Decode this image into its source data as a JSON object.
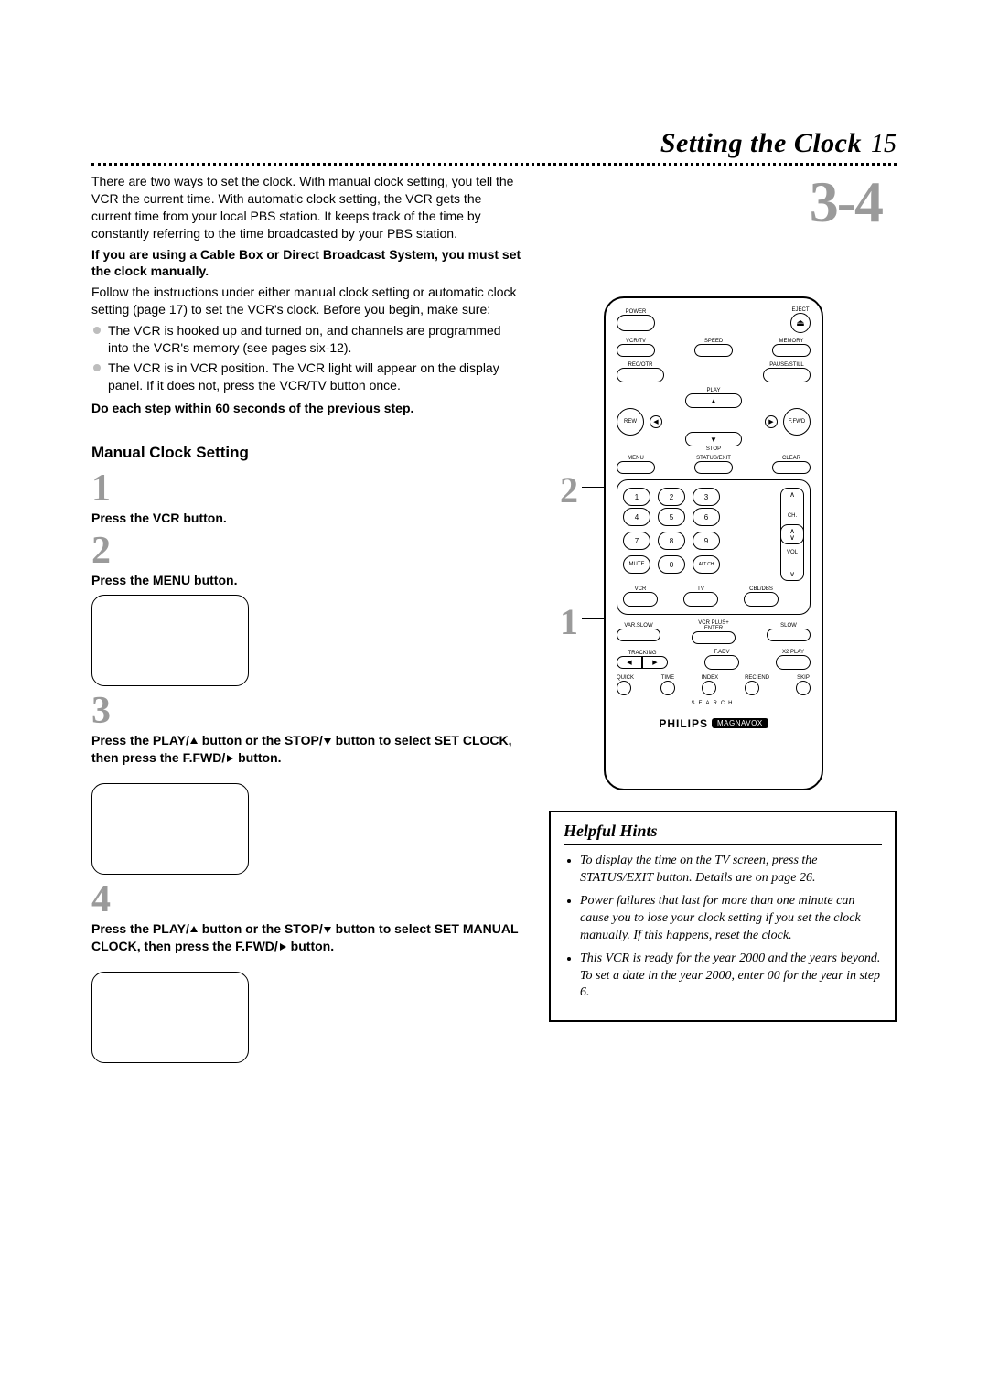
{
  "header": {
    "title": "Setting the Clock",
    "page_number_side": "15",
    "big_step_range": "3-4"
  },
  "intro": {
    "p1": "There are two ways to set the clock. With manual clock setting, you tell the VCR the current time. With automatic clock setting, the VCR gets the current time from your local PBS station. It keeps track of the time by constantly referring to the time broadcasted by your PBS station.",
    "bold1": "If you are using a Cable Box or Direct Broadcast System, you must set the clock manually.",
    "p2": "Follow the instructions under either manual clock setting or automatic clock setting (page 17) to set the VCR's clock. Before you begin, make sure:",
    "bullets": [
      "The VCR is hooked up and turned on, and channels are programmed into the VCR's memory (see pages six-12).",
      "The VCR is in VCR position. The VCR light will appear on the display panel. If it does not, press the VCR/TV button once."
    ],
    "bold2": "Do each step within 60 seconds of the previous step."
  },
  "manual": {
    "heading": "Manual Clock Setting",
    "steps": [
      {
        "n": "1",
        "text": "Press the VCR button."
      },
      {
        "n": "2",
        "text": "Press the MENU button."
      },
      {
        "n": "3",
        "text_a": "Press the PLAY/",
        "text_b": " button or the STOP/",
        "text_c": " button to select SET CLOCK, then press the F.FWD/",
        "text_d": " button."
      },
      {
        "n": "4",
        "text_a": "Press the PLAY/",
        "text_b": " button or the STOP/",
        "text_c": " button to select SET MANUAL CLOCK, then press the F.FWD/",
        "text_d": " button."
      }
    ]
  },
  "hints": {
    "title": "Helpful Hints",
    "items": [
      "To display the time on the TV screen, press the STATUS/EXIT button. Details are on page 26.",
      "Power failures that last for more than one minute can cause you to lose your clock setting if you set the clock manually. If this happens, reset the clock.",
      "This VCR is ready for the year 2000 and the years beyond. To set a date in the year 2000, enter 00 for the year in step 6."
    ]
  },
  "remote": {
    "callouts": {
      "c1": "1",
      "c2": "2"
    },
    "labels": {
      "power": "POWER",
      "eject": "EJECT",
      "vcrtv": "VCR/TV",
      "speed": "SPEED",
      "memory": "MEMORY",
      "recotr": "REC/OTR",
      "pausestill": "PAUSE/STILL",
      "play": "PLAY",
      "stop": "STOP",
      "rew": "REW",
      "ffwd": "F.FWD",
      "menu": "MENU",
      "statusexit": "STATUS/EXIT",
      "clear": "CLEAR",
      "mute": "MUTE",
      "altch": "ALT.CH",
      "ch": "CH.",
      "vol": "VOL",
      "vcr": "VCR",
      "tv": "TV",
      "cblbox": "CBL/DBS",
      "varslow": "VAR.SLOW",
      "vcrplus": "VCR PLUS+",
      "enter": "ENTER",
      "slow": "SLOW",
      "tracking": "TRACKING",
      "fadv": "F.ADV",
      "x2play": "X2 PLAY",
      "quick": "QUICK",
      "time": "TIME",
      "index": "INDEX",
      "recend": "REC END",
      "skip": "SKIP",
      "search": "SEARCH"
    },
    "keypad": [
      "1",
      "2",
      "3",
      "4",
      "5",
      "6",
      "7",
      "8",
      "9",
      "0"
    ],
    "brand": {
      "name": "PHILIPS",
      "tag": "MAGNAVOX"
    }
  },
  "icons": {
    "up": "▲",
    "down": "▼",
    "right": "▶",
    "left": "◀",
    "eject": "⏏"
  }
}
